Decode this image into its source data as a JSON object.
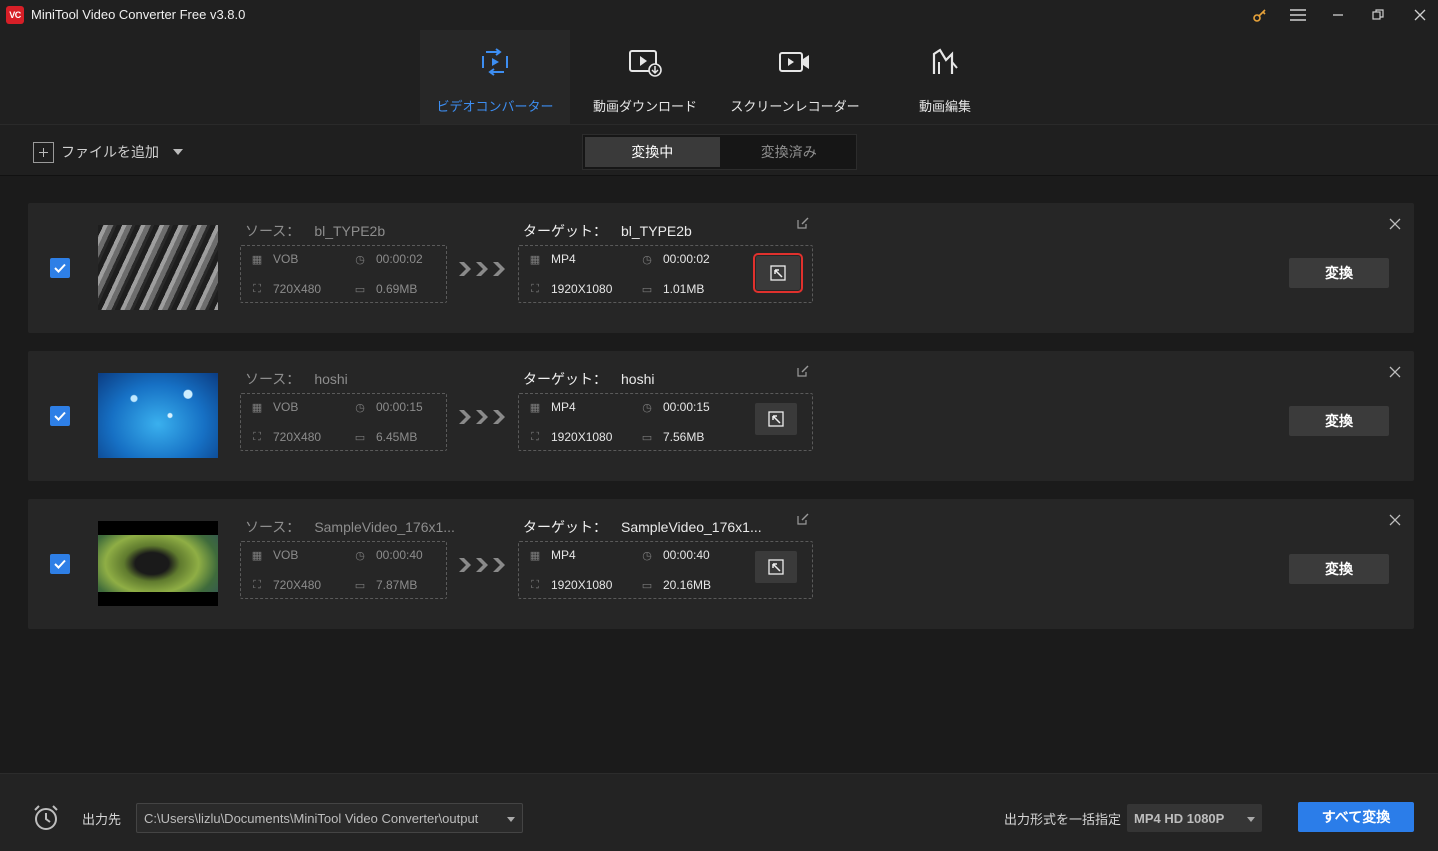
{
  "app": {
    "title": "MiniTool Video Converter Free v3.8.0",
    "logo_text": "VC",
    "accent_color": "#2b7de9",
    "highlight_color": "#e0312d"
  },
  "window_controls": [
    "key-icon",
    "menu-icon",
    "minimize-icon",
    "restore-icon",
    "close-icon"
  ],
  "nav": {
    "tabs": [
      {
        "label": "ビデオコンバーター",
        "icon": "convert-icon",
        "active": true
      },
      {
        "label": "動画ダウンロード",
        "icon": "download-icon",
        "active": false
      },
      {
        "label": "スクリーンレコーダー",
        "icon": "recorder-icon",
        "active": false
      },
      {
        "label": "動画編集",
        "icon": "editor-icon",
        "active": false
      }
    ]
  },
  "toolbar": {
    "add_file_label": "ファイルを追加",
    "tab_converting": "変換中",
    "tab_converted": "変換済み"
  },
  "labels": {
    "source": "ソース：",
    "target": "ターゲット：",
    "convert": "変換"
  },
  "files": [
    {
      "checked": true,
      "source": {
        "name": "bl_TYPE2b",
        "format": "VOB",
        "duration": "00:00:02",
        "resolution": "720X480",
        "size": "0.69MB"
      },
      "target": {
        "name": "bl_TYPE2b",
        "format": "MP4",
        "duration": "00:00:02",
        "resolution": "1920X1080",
        "size": "1.01MB"
      },
      "settings_highlighted": true
    },
    {
      "checked": true,
      "source": {
        "name": "hoshi",
        "format": "VOB",
        "duration": "00:00:15",
        "resolution": "720X480",
        "size": "6.45MB"
      },
      "target": {
        "name": "hoshi",
        "format": "MP4",
        "duration": "00:00:15",
        "resolution": "1920X1080",
        "size": "7.56MB"
      },
      "settings_highlighted": false
    },
    {
      "checked": true,
      "source": {
        "name": "SampleVideo_176x1...",
        "format": "VOB",
        "duration": "00:00:40",
        "resolution": "720X480",
        "size": "7.87MB"
      },
      "target": {
        "name": "SampleVideo_176x1...",
        "format": "MP4",
        "duration": "00:00:40",
        "resolution": "1920X1080",
        "size": "20.16MB"
      },
      "settings_highlighted": false
    }
  ],
  "bottom": {
    "output_label": "出力先",
    "output_path": "C:\\Users\\lizlu\\Documents\\MiniTool Video Converter\\output",
    "format_label": "出力形式を一括指定",
    "format_value": "MP4 HD 1080P",
    "convert_all_label": "すべて変換"
  }
}
